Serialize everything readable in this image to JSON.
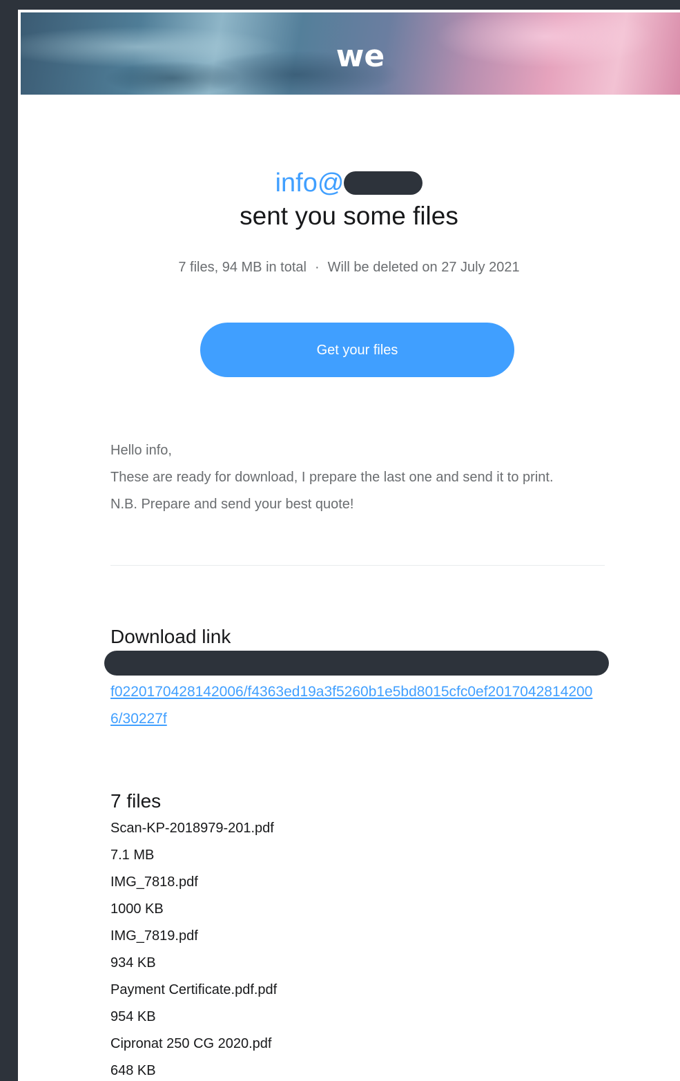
{
  "brand": {
    "logo_text": "we"
  },
  "colors": {
    "accent": "#409fff",
    "page_background": "#2d333b",
    "text_primary": "#17181a",
    "text_secondary": "#6a6d70"
  },
  "header": {
    "sender_prefix": "info@",
    "headline": "sent you some files"
  },
  "summary": {
    "files_total": "7 files, 94 MB in total",
    "separator": "·",
    "expiry": "Will be deleted on 27 July 2021"
  },
  "cta": {
    "label": "Get your files"
  },
  "message": {
    "lines": [
      "Hello info,",
      "These are ready for download, I prepare the last one and send it to print.",
      "N.B. Prepare and send your best quote!"
    ]
  },
  "download": {
    "title": "Download link",
    "link_visible": "f0220170428142006/f4363ed19a3f5260b1e5bd8015cfc0ef20170428142006/30227f"
  },
  "files": {
    "title": "7 files",
    "items": [
      {
        "name": "Scan-KP-2018979-201.pdf",
        "size": "7.1 MB"
      },
      {
        "name": "IMG_7818.pdf",
        "size": "1000 KB"
      },
      {
        "name": "IMG_7819.pdf",
        "size": "934 KB"
      },
      {
        "name": "Payment Certificate.pdf.pdf",
        "size": "954 KB"
      },
      {
        "name": "Cipronat 250 CG 2020.pdf",
        "size": "648 KB"
      }
    ]
  }
}
